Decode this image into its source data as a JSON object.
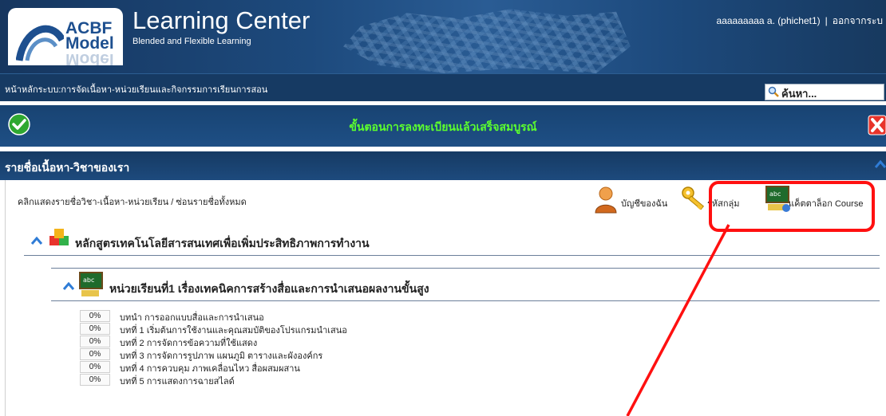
{
  "header": {
    "logo_acbf": "ACBF",
    "logo_model": "Model",
    "site_title": "Learning Center",
    "site_subtitle": "Blended and Flexible Learning",
    "user_name": "aaaaaaaaa a. (phichet1)",
    "logout_label": "ออกจากระบ"
  },
  "nav": {
    "breadcrumb": "หน้าหลักระบบ:การจัดเนื้อหา-หน่วยเรียนและกิจกรรมการเรียนการสอน",
    "search_label": "ค้นหา..."
  },
  "banner": {
    "message": "ขั้นตอนการลงทะเบียนแล้วเสร็จสมบูรณ์"
  },
  "panel": {
    "title": "รายชื่อเนื้อหา-วิชาของเรา",
    "toggle_link": "คลิกแสดงรายชื่อวิชา-เนื้อหา-หน่วยเรียน / ซ่อนรายชื่อทั้งหมด",
    "tools": {
      "account": "บัญชีของฉัน",
      "group_code": "รหัสกลุ่ม",
      "catalog": "แค็ตตาล็อก Course"
    }
  },
  "course": {
    "title": "หลักสูตรเทคโนโลยีสารสนเทศเพื่อเพิ่มประสิทธิภาพการทำงาน",
    "unit": {
      "title": "หน่วยเรียนที่1 เรื่องเทคนิคการสร้างสื่อและการนำเสนอผลงานขั้นสูง",
      "lessons": [
        {
          "progress": "0%",
          "title": "บทนำ การออกแบบสื่อและการนำเสนอ"
        },
        {
          "progress": "0%",
          "title": "บทที่ 1 เริ่มต้นการใช้งานและคุณสมบัติของโปรแกรมนำเสนอ"
        },
        {
          "progress": "0%",
          "title": "บทที่ 2 การจัดการข้อความที่ใช้แสดง"
        },
        {
          "progress": "0%",
          "title": "บทที่ 3 การจัดการรูปภาพ แผนภูมิ ตารางและผังองค์กร"
        },
        {
          "progress": "0%",
          "title": "บทที่ 4 การควบคุม ภาพเคลื่อนไหว สื่อผสมผสาน"
        },
        {
          "progress": "0%",
          "title": "บทที่ 5 การแสดงการฉายสไลด์"
        }
      ]
    }
  },
  "colors": {
    "header_blue": "#1d4a7d",
    "banner_text_green": "#5cff2e",
    "highlight_red": "#ff1010"
  },
  "icons": {
    "success": "check-circle-icon",
    "close": "close-x-icon",
    "search": "magnifier-icon",
    "account": "user-icon",
    "group": "key-icon",
    "catalog": "chalkboard-icon",
    "course": "cubes-icon",
    "unit": "chalkboard-icon",
    "expand": "chevron-up-icon"
  }
}
